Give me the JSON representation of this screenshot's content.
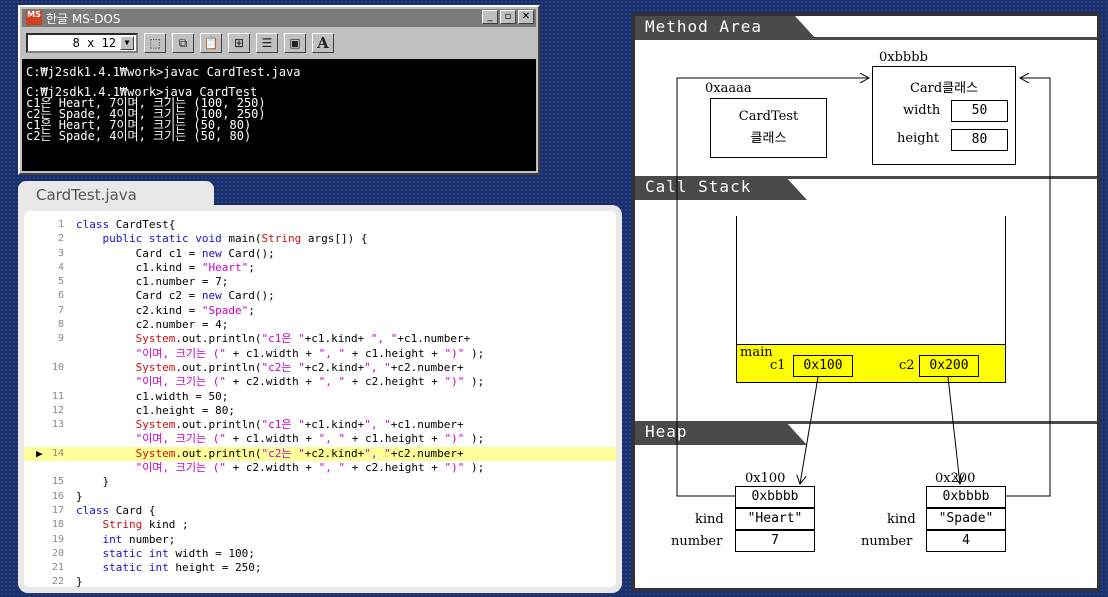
{
  "dos_window": {
    "title": "한글 MS-DOS",
    "icon_text": "MS",
    "title_buttons": [
      "_",
      "▫",
      "✕"
    ],
    "font_size": "8 x 12",
    "console_lines": [
      "C:₩j2sdk1.4.1₩work>javac CardTest.java",
      "",
      "C:₩j2sdk1.4.1₩work>java CardTest",
      "c1은 Heart, 7이며, 크기는 (100, 250)",
      "c2는 Spade, 4이며, 크기는 (100, 250)",
      "c1은 Heart, 7이며, 크기는 (50, 80)",
      "c2는 Spade, 4이며, 크기는 (50, 80)"
    ]
  },
  "editor": {
    "tab_label": "CardTest.java",
    "current_line": 14,
    "lines": [
      {
        "n": "1",
        "html": "<span class=\"kw\">class</span> CardTest{"
      },
      {
        "n": "2",
        "html": "    <span class=\"kw\">public static void</span> main(<span class=\"typ\">String</span> args[]) {"
      },
      {
        "n": "3",
        "html": "         Card c1 = <span class=\"kw\">new</span> Card();"
      },
      {
        "n": "4",
        "html": "         c1.kind = <span class=\"str\">\"Heart\"</span>;"
      },
      {
        "n": "5",
        "html": "         c1.number = 7;"
      },
      {
        "n": "6",
        "html": "         Card c2 = <span class=\"kw\">new</span> Card();"
      },
      {
        "n": "7",
        "html": "         c2.kind = <span class=\"str\">\"Spade\"</span>;"
      },
      {
        "n": "8",
        "html": "         c2.number = 4;"
      },
      {
        "n": "9",
        "html": "         <span class=\"typ\">System</span>.out.println(<span class=\"str\">\"c1은 \"</span>+c1.kind+ <span class=\"str\">\", \"</span>+c1.number+"
      },
      {
        "n": "",
        "html": "         <span class=\"str\">\"이며, 크기는 (\"</span> + c1.width + <span class=\"str\">\", \"</span> + c1.height + <span class=\"str\">\")\"</span> );"
      },
      {
        "n": "10",
        "html": "         <span class=\"typ\">System</span>.out.println(<span class=\"str\">\"c2는 \"</span>+c2.kind+<span class=\"str\">\", \"</span>+c2.number+"
      },
      {
        "n": "",
        "html": "         <span class=\"str\">\"이며, 크기는 (\"</span> + c2.width + <span class=\"str\">\", \"</span> + c2.height + <span class=\"str\">\")\"</span> );"
      },
      {
        "n": "11",
        "html": "         c1.width = 50;"
      },
      {
        "n": "12",
        "html": "         c1.height = 80;"
      },
      {
        "n": "13",
        "html": "         <span class=\"typ\">System</span>.out.println(<span class=\"str\">\"c1은 \"</span>+c1.kind+<span class=\"str\">\", \"</span>+c1.number+"
      },
      {
        "n": "",
        "html": "         <span class=\"str\">\"이며, 크기는 (\"</span> + c1.width + <span class=\"str\">\", \"</span> + c1.height + <span class=\"str\">\")\"</span> );"
      },
      {
        "n": "14",
        "html": "         <span class=\"typ\">System</span>.out.println(<span class=\"str\">\"c2는 \"</span>+c2.kind+<span class=\"str\">\", \"</span>+c2.number+",
        "hl": true
      },
      {
        "n": "",
        "html": "         <span class=\"str\">\"이며, 크기는 (\"</span> + c2.width + <span class=\"str\">\", \"</span> + c2.height + <span class=\"str\">\")\"</span> );"
      },
      {
        "n": "15",
        "html": "    }"
      },
      {
        "n": "16",
        "html": "}"
      },
      {
        "n": "17",
        "html": "<span class=\"kw\">class</span> Card {"
      },
      {
        "n": "18",
        "html": "    <span class=\"typ\">String</span> kind ;"
      },
      {
        "n": "19",
        "html": "    <span class=\"kw\">int</span> number;"
      },
      {
        "n": "20",
        "html": "    <span class=\"kw\">static int</span> width = 100;"
      },
      {
        "n": "21",
        "html": "    <span class=\"kw\">static int</span> height = 250;"
      },
      {
        "n": "22",
        "html": "}"
      }
    ]
  },
  "memory": {
    "method_area": {
      "title": "Method Area",
      "cardtest_addr": "0xaaaa",
      "cardtest_label_1": "CardTest",
      "cardtest_label_2": "클래스",
      "card_addr": "0xbbbb",
      "card_label": "Card클래스",
      "width_label": "width",
      "width_value": "50",
      "height_label": "height",
      "height_value": "80"
    },
    "call_stack": {
      "title": "Call Stack",
      "frame_label": "main",
      "c1_label": "c1",
      "c1_value": "0x100",
      "c2_label": "c2",
      "c2_value": "0x200"
    },
    "heap": {
      "title": "Heap",
      "obj1": {
        "addr": "0x100",
        "class_ref": "0xbbbb",
        "kind_label": "kind",
        "kind": "\"Heart\"",
        "number_label": "number",
        "number": "7"
      },
      "obj2": {
        "addr": "0x200",
        "class_ref": "0xbbbb",
        "kind_label": "kind",
        "kind": "\"Spade\"",
        "number_label": "number",
        "number": "4"
      }
    }
  }
}
